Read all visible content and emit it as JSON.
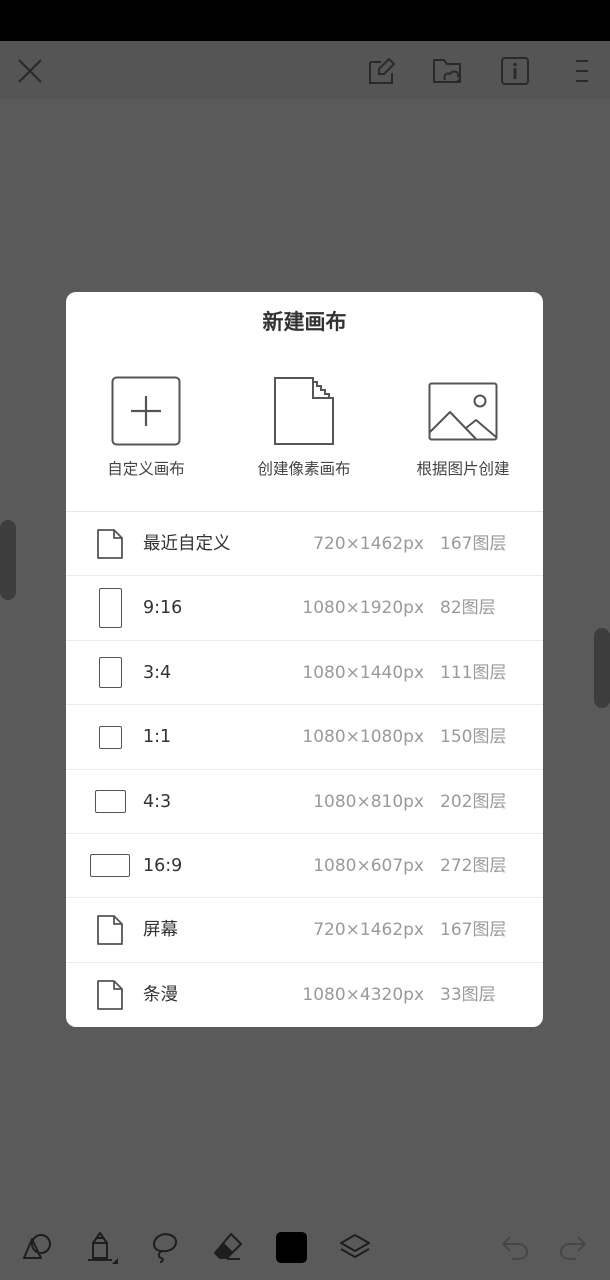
{
  "dialog": {
    "title": "新建画布",
    "options": [
      {
        "label": "自定义画布",
        "icon": "add-square-icon"
      },
      {
        "label": "创建像素画布",
        "icon": "pixel-document-icon"
      },
      {
        "label": "根据图片创建",
        "icon": "image-icon"
      }
    ],
    "presets": [
      {
        "name": "最近自定义",
        "size": "720×1462px",
        "layers": "167图层",
        "icon": "document-icon"
      },
      {
        "name": "9:16",
        "size": "1080×1920px",
        "layers": "82图层",
        "icon": "portrait-rect-icon"
      },
      {
        "name": "3:4",
        "size": "1080×1440px",
        "layers": "111图层",
        "icon": "portrait-rect-icon"
      },
      {
        "name": "1:1",
        "size": "1080×1080px",
        "layers": "150图层",
        "icon": "square-icon"
      },
      {
        "name": "4:3",
        "size": "1080×810px",
        "layers": "202图层",
        "icon": "landscape-rect-icon"
      },
      {
        "name": "16:9",
        "size": "1080×607px",
        "layers": "272图层",
        "icon": "landscape-rect-icon"
      },
      {
        "name": "屏幕",
        "size": "720×1462px",
        "layers": "167图层",
        "icon": "document-icon"
      },
      {
        "name": "条漫",
        "size": "1080×4320px",
        "layers": "33图层",
        "icon": "document-icon"
      }
    ]
  },
  "top_toolbar": {
    "icons": [
      "close-icon",
      "canvas-edit-icon",
      "folder-image-icon",
      "info-icon",
      "menu-icon"
    ]
  },
  "bottom_toolbar": {
    "icons": [
      "shapes-icon",
      "pencil-icon",
      "lasso-icon",
      "eraser-icon",
      "color-swatch-icon",
      "layers-icon",
      "undo-icon",
      "redo-icon"
    ],
    "current_color": "#000000"
  },
  "colors": {
    "overlay": "#5a5a5a",
    "dialog_bg": "#ffffff",
    "primary_text": "#333333",
    "secondary_text": "#9a9a9a"
  }
}
